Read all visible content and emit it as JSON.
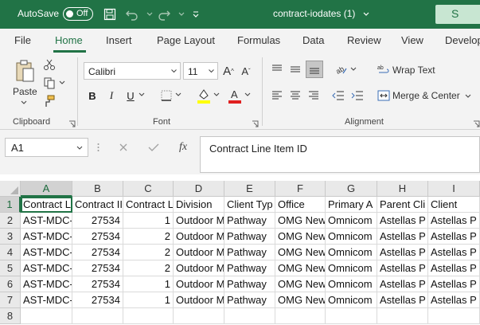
{
  "titlebar": {
    "autosave_label": "AutoSave",
    "autosave_state": "Off",
    "doc_title": "contract-iodates (1)",
    "search_letter": "S"
  },
  "tabs": [
    "File",
    "Home",
    "Insert",
    "Page Layout",
    "Formulas",
    "Data",
    "Review",
    "View",
    "Develop"
  ],
  "ribbon": {
    "paste_label": "Paste",
    "font_name": "Calibri",
    "font_size": "11",
    "wrap_text": "Wrap Text",
    "merge_center": "Merge & Center",
    "groups": [
      "Clipboard",
      "Font",
      "Alignment"
    ],
    "colors": {
      "highlight": "#ffff00",
      "font_color": "#e02020",
      "accent": "#217346"
    }
  },
  "formula_bar": {
    "name_box": "A1",
    "fx": "fx",
    "content": "Contract Line Item ID"
  },
  "grid": {
    "columns": [
      "A",
      "B",
      "C",
      "D",
      "E",
      "F",
      "G",
      "H",
      "I"
    ],
    "rows": [
      "1",
      "2",
      "3",
      "4",
      "5",
      "6",
      "7",
      "8"
    ],
    "header_row": [
      "Contract L",
      "Contract II",
      "Contract L",
      "Division",
      "Client Typ",
      "Office",
      "Primary A",
      "Parent Cli",
      "Client"
    ],
    "data_rows": [
      [
        "AST-MDC-",
        "27534",
        "1",
        "Outdoor M",
        "Pathway",
        "OMG New",
        "Omnicom",
        "Astellas P",
        "Astellas P"
      ],
      [
        "AST-MDC-",
        "27534",
        "2",
        "Outdoor M",
        "Pathway",
        "OMG New",
        "Omnicom",
        "Astellas P",
        "Astellas P"
      ],
      [
        "AST-MDC-",
        "27534",
        "2",
        "Outdoor M",
        "Pathway",
        "OMG New",
        "Omnicom",
        "Astellas P",
        "Astellas P"
      ],
      [
        "AST-MDC-",
        "27534",
        "2",
        "Outdoor M",
        "Pathway",
        "OMG New",
        "Omnicom",
        "Astellas P",
        "Astellas P"
      ],
      [
        "AST-MDC-",
        "27534",
        "1",
        "Outdoor M",
        "Pathway",
        "OMG New",
        "Omnicom",
        "Astellas P",
        "Astellas P"
      ],
      [
        "AST-MDC-",
        "27534",
        "1",
        "Outdoor M",
        "Pathway",
        "OMG New",
        "Omnicom",
        "Astellas P",
        "Astellas P"
      ]
    ],
    "active_cell": "A1"
  }
}
